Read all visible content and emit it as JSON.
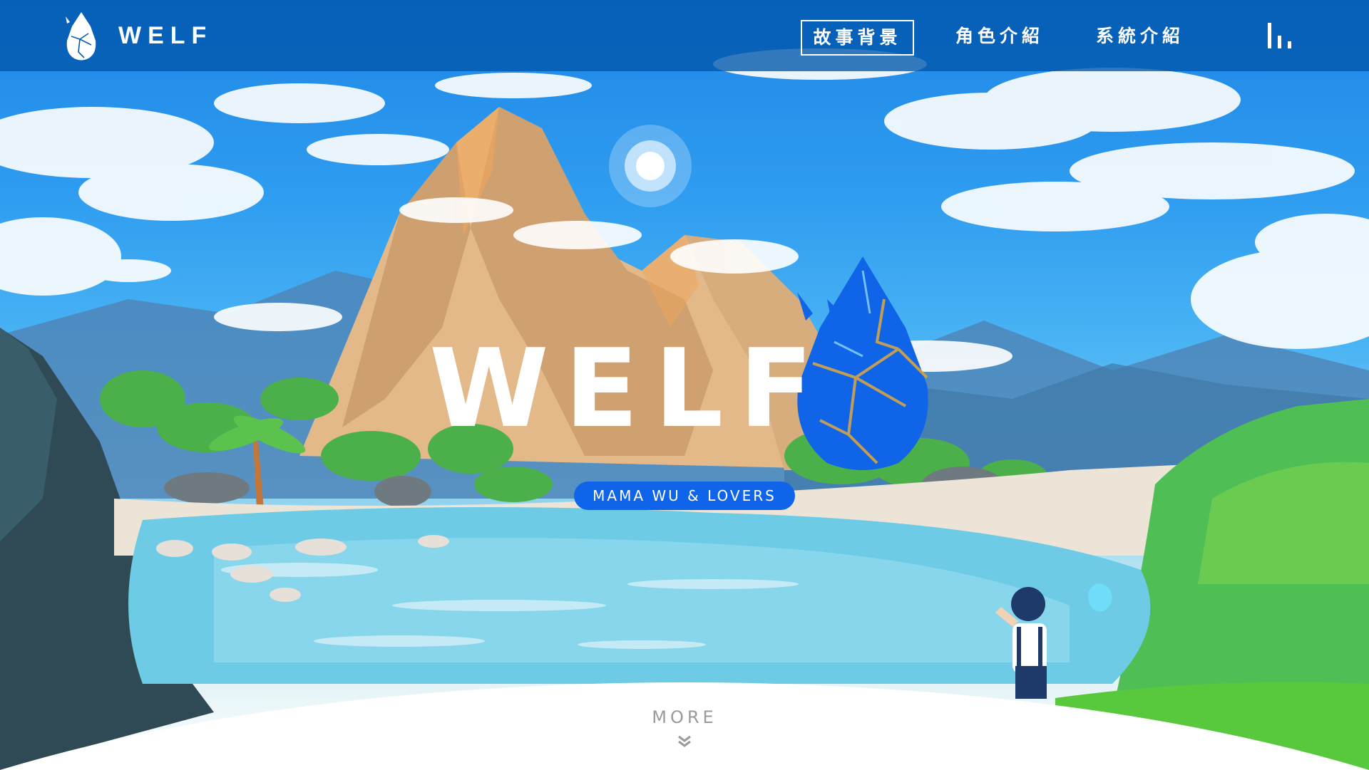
{
  "header": {
    "brand_text": "WELF",
    "nav": [
      {
        "label": "故事背景",
        "active": true
      },
      {
        "label": "角色介紹",
        "active": false
      },
      {
        "label": "系統介紹",
        "active": false
      }
    ],
    "menu_icon": "bars-icon"
  },
  "hero": {
    "title": "WELF",
    "tagline": "MAMA WU & LOVERS",
    "logo_icon": "crystal-drop-icon"
  },
  "more": {
    "label": "MORE",
    "icon": "double-chevron-down-icon"
  },
  "colors": {
    "header_bg": "#0056aa",
    "accent": "#1064ea",
    "more_text": "#9a9a9a",
    "sky": "#2e9cf0"
  }
}
